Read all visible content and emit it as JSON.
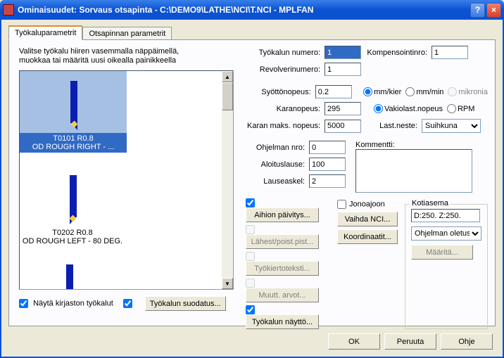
{
  "window": {
    "title": "Ominaisuudet: Sorvaus otsapinta - C:\\DEMO9\\LATHE\\NCI\\T.NCI - MPLFAN"
  },
  "tabs": {
    "tab0": "Työkaluparametrit",
    "tab1": "Otsapinnan parametrit"
  },
  "instructions": "Valitse työkalu hiiren vasemmalla näppäimellä, muokkaa tai määritä uusi oikealla painikkeella",
  "tools": {
    "t1_line1": "T0101 R0.8",
    "t1_line2": "OD ROUGH RIGHT - ...",
    "t2_line1": "T0202 R0.8",
    "t2_line2": "OD ROUGH LEFT - 80 DEG."
  },
  "bottom": {
    "show_lib": "Näytä kirjaston työkalut",
    "filter": "Työkalun suodatus..."
  },
  "form": {
    "tool_no_lbl": "Työkalun numero:",
    "tool_no": "1",
    "comp_lbl": "Kompensointinro:",
    "comp": "1",
    "rev_lbl": "Revolverinumero:",
    "rev": "1",
    "feed_lbl": "Syöttönopeus:",
    "feed": "0.2",
    "r_mmkier": "mm/kier",
    "r_mmmin": "mm/min",
    "r_mikronia": "mikronia",
    "spindle_lbl": "Karanopeus:",
    "spindle": "295",
    "r_vakio": "Vakiolast.nopeus",
    "r_rpm": "RPM",
    "maxsp_lbl": "Karan maks. nopeus:",
    "maxsp": "5000",
    "coolant_lbl": "Last.neste:",
    "coolant_val": "Suihkuna",
    "prog_lbl": "Ohjelman nro:",
    "prog": "0",
    "start_lbl": "Aloituslause:",
    "start": "100",
    "step_lbl": "Lauseaskel:",
    "step": "2",
    "comment_lbl": "Kommentti:"
  },
  "actions": {
    "aihion": "Aihion päivitys...",
    "lahest": "Lähest/poist.pist...",
    "tyokierto": "Työkiertoteksti...",
    "muutt": "Muutt. arvot...",
    "jono": "Jonoajoon",
    "vaihda": "Vaihda NCI...",
    "koord": "Koordinaatit...",
    "tyokalun": "Työkalun näyttö...",
    "kotiasema": "Kotiasema",
    "kotiasema_val": "D:250. Z:250.",
    "ohjelman_oletus": "Ohjelman oletus",
    "maarita": "Määritä..."
  },
  "buttons": {
    "ok": "OK",
    "cancel": "Peruuta",
    "help": "Ohje"
  }
}
